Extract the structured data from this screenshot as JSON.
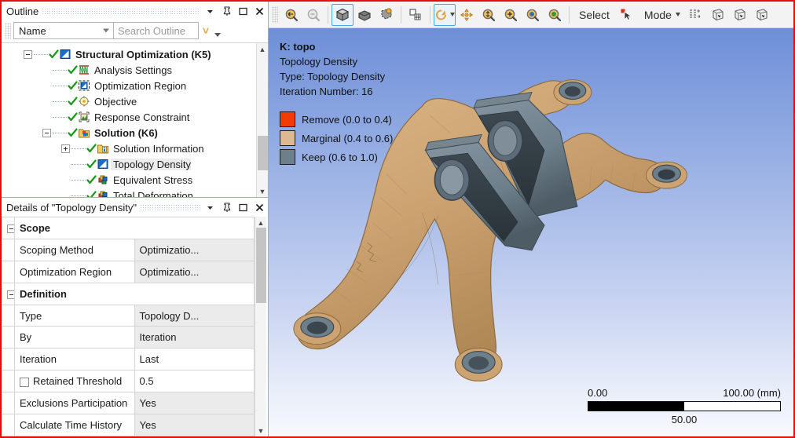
{
  "outline_panel": {
    "title": "Outline",
    "buttons": {
      "dropdown": "dropdown-arrow",
      "pin": "pin",
      "maximize": "maximize",
      "close": "close"
    },
    "filter": {
      "selected": "Name",
      "search_placeholder": "Search Outline"
    },
    "tree": [
      {
        "level": 0,
        "label": "Structural Optimization (K5)",
        "bold": true,
        "expander": "minus",
        "check": true,
        "icon": "topology-icon",
        "selected": false
      },
      {
        "level": 1,
        "label": "Analysis Settings",
        "bold": false,
        "expander": "none",
        "check": true,
        "icon": "analysis-settings-icon",
        "selected": false
      },
      {
        "level": 1,
        "label": "Optimization Region",
        "bold": false,
        "expander": "none",
        "check": true,
        "icon": "optimization-region-icon",
        "selected": false
      },
      {
        "level": 1,
        "label": "Objective",
        "bold": false,
        "expander": "none",
        "check": true,
        "icon": "objective-icon",
        "selected": false
      },
      {
        "level": 1,
        "label": "Response Constraint",
        "bold": false,
        "expander": "none",
        "check": true,
        "icon": "response-constraint-icon",
        "selected": false
      },
      {
        "level": 1,
        "label": "Solution (K6)",
        "bold": true,
        "expander": "minus",
        "check": true,
        "icon": "solution-icon",
        "selected": false
      },
      {
        "level": 2,
        "label": "Solution Information",
        "bold": false,
        "expander": "plus",
        "check": true,
        "icon": "solution-info-icon",
        "selected": false
      },
      {
        "level": 2,
        "label": "Topology Density",
        "bold": false,
        "expander": "none",
        "check": true,
        "icon": "topology-icon",
        "selected": true
      },
      {
        "level": 2,
        "label": "Equivalent Stress",
        "bold": false,
        "expander": "none",
        "check": true,
        "icon": "result-icon",
        "selected": false
      },
      {
        "level": 2,
        "label": "Total Deformation",
        "bold": false,
        "expander": "none",
        "check": true,
        "icon": "result-icon",
        "selected": false
      }
    ]
  },
  "details_panel": {
    "title": "Details of \"Topology Density\"",
    "buttons": {
      "dropdown": "dropdown-arrow",
      "pin": "pin",
      "maximize": "maximize",
      "close": "close"
    },
    "rows": [
      {
        "kind": "group",
        "label": "Scope"
      },
      {
        "kind": "prop",
        "label": "Scoping Method",
        "value": "Optimizatio...",
        "alt": true,
        "checkbox": false
      },
      {
        "kind": "prop",
        "label": "Optimization Region",
        "value": "Optimizatio...",
        "alt": true,
        "checkbox": false
      },
      {
        "kind": "group",
        "label": "Definition"
      },
      {
        "kind": "prop",
        "label": "Type",
        "value": "Topology D...",
        "alt": true,
        "checkbox": false
      },
      {
        "kind": "prop",
        "label": "By",
        "value": "Iteration",
        "alt": true,
        "checkbox": false
      },
      {
        "kind": "prop",
        "label": "Iteration",
        "value": "Last",
        "alt": false,
        "checkbox": false
      },
      {
        "kind": "prop",
        "label": "Retained Threshold",
        "value": "0.5",
        "alt": false,
        "checkbox": true
      },
      {
        "kind": "prop",
        "label": "Exclusions Participation",
        "value": "Yes",
        "alt": true,
        "checkbox": false
      },
      {
        "kind": "prop",
        "label": "Calculate Time History",
        "value": "Yes",
        "alt": true,
        "checkbox": false
      }
    ]
  },
  "toolbar": {
    "items": [
      {
        "name": "zoom-to-fit-icon",
        "type": "icon",
        "active": false
      },
      {
        "name": "zoom-previous-icon",
        "type": "icon",
        "active": false
      },
      {
        "sep": true
      },
      {
        "name": "show-solid-body-icon",
        "type": "icon",
        "active": true
      },
      {
        "name": "show-shaded-body-icon",
        "type": "icon",
        "active": false
      },
      {
        "name": "show-wireframe-icon",
        "type": "icon",
        "active": false
      },
      {
        "sep": true
      },
      {
        "name": "show-mesh-icon",
        "type": "icon",
        "active": false
      },
      {
        "sep": true
      },
      {
        "name": "rotate-icon",
        "type": "icon",
        "active": true,
        "caret": true
      },
      {
        "name": "pan-icon",
        "type": "icon",
        "active": false
      },
      {
        "name": "zoom-box-icon",
        "type": "icon",
        "active": false
      },
      {
        "name": "zoom-in-icon",
        "type": "icon",
        "active": false
      },
      {
        "name": "zoom-fit-blue-icon",
        "type": "icon",
        "active": false
      },
      {
        "name": "zoom-fit-green-icon",
        "type": "icon",
        "active": false
      },
      {
        "sep": true
      },
      {
        "name": "select-label",
        "type": "text",
        "label": "Select"
      },
      {
        "name": "cursor-mode-icon",
        "type": "icon",
        "active": false
      },
      {
        "name": "mode-label",
        "type": "text",
        "label": "Mode",
        "caret": true
      },
      {
        "name": "edge-graphics-icon",
        "type": "icon",
        "active": false
      },
      {
        "name": "named-selection-1-icon",
        "type": "icon",
        "active": false
      },
      {
        "name": "named-selection-2-icon",
        "type": "icon",
        "active": false
      },
      {
        "name": "named-selection-3-icon",
        "type": "icon",
        "active": false
      }
    ],
    "select_label": "Select",
    "mode_label": "Mode"
  },
  "viewport": {
    "legend": {
      "title": "K: topo",
      "line2": "Topology Density",
      "line3": "Type: Topology Density",
      "line4": "Iteration Number: 16",
      "entries": [
        {
          "label": "Remove (0.0 to 0.4)",
          "color": "#f13c05"
        },
        {
          "label": "Marginal (0.4 to 0.6)",
          "color": "#ddb991"
        },
        {
          "label": "Keep (0.6 to 1.0)",
          "color": "#6d7f8b"
        }
      ]
    },
    "scale_bar": {
      "min": "0.00",
      "max": "100.00 (mm)",
      "mid": "50.00"
    },
    "model": {
      "name": "topology-optimized-bracket",
      "body_color": "#cda372",
      "keep_color": "#6d7f8b"
    }
  },
  "colors": {
    "window_border": "#e01010",
    "viewport_top": "#6e8ed7",
    "viewport_bottom": "#f7f9fd",
    "accent": "#4ba3e3"
  }
}
